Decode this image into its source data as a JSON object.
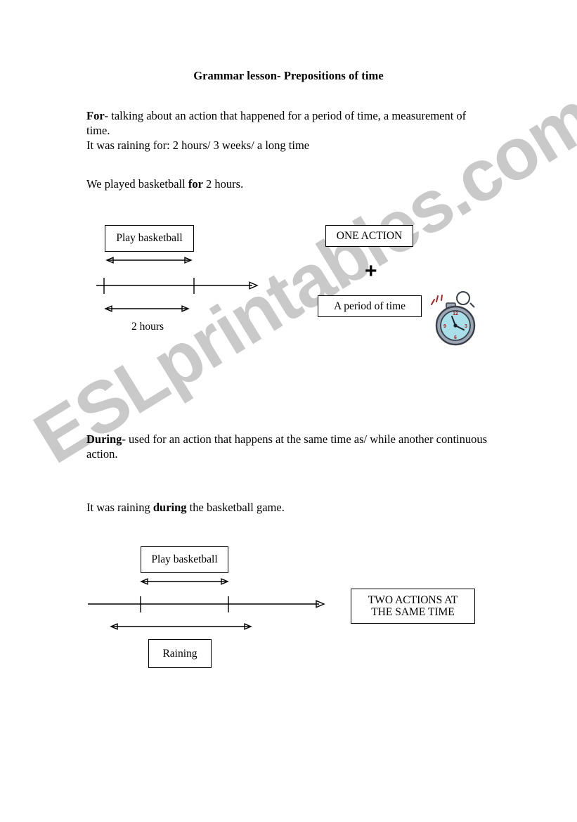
{
  "document": {
    "title": "Grammar lesson- Prepositions of time",
    "watermark": "ESLprintables.com",
    "watermark_color": "#c9c9c9"
  },
  "sections": {
    "for": {
      "rule_lead": "For",
      "rule_rest": "- talking about an action that happened for a period of time, a measurement of time.",
      "example_rule": "It was raining for: 2 hours/ 3 weeks/ a long time",
      "sentence_before": "We played basketball ",
      "sentence_bold": "for",
      "sentence_after": " 2 hours."
    },
    "during": {
      "rule_lead": "During",
      "rule_rest": "- used for an action that happens at the same time as/ while another continuous action.",
      "sentence_before": "It was raining ",
      "sentence_bold": "during",
      "sentence_after": " the basketball game."
    }
  },
  "diagram_for": {
    "action_box": "Play basketball",
    "duration_label": "2 hours",
    "summary_box_1": "ONE ACTION",
    "plus": "+",
    "summary_box_2": "A period of time",
    "clipart": "stopwatch-icon",
    "clipart_colors": {
      "face": "#a8dfe8",
      "rim": "#9aa6b4",
      "numerals": "#b02020",
      "outline": "#3a3f4a"
    }
  },
  "diagram_during": {
    "action_box": "Play basketball",
    "second_action_box": "Raining",
    "summary_line_1": "TWO ACTIONS AT",
    "summary_line_2": "THE SAME TIME"
  }
}
